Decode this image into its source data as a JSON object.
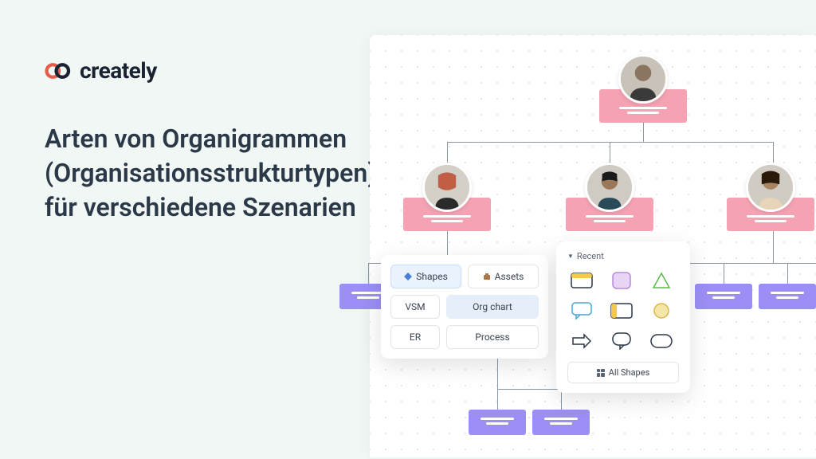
{
  "brand": {
    "name": "creately"
  },
  "heading": "Arten von Organigrammen (Organisationsstrukturtypen) für verschiedene Szenarien",
  "panel": {
    "tabs": {
      "shapes": "Shapes",
      "assets": "Assets"
    },
    "categories": {
      "vsm": "VSM",
      "org": "Org chart",
      "er": "ER",
      "process": "Process"
    }
  },
  "shapes": {
    "recent_label": "Recent",
    "all_shapes": "All Shapes"
  }
}
